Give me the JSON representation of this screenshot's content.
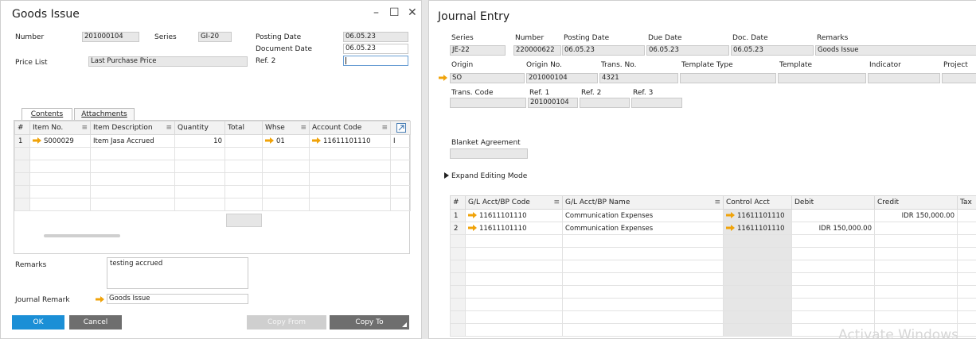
{
  "goods_issue": {
    "title": "Goods Issue",
    "controls": {
      "minimize": "–",
      "maximize": "☐",
      "close": "✕"
    },
    "number_label": "Number",
    "number_value": "201000104",
    "series_label": "Series",
    "series_value": "GI-20",
    "posting_date_label": "Posting Date",
    "posting_date_value": "06.05.23",
    "document_date_label": "Document Date",
    "document_date_value": "06.05.23",
    "ref2_label": "Ref. 2",
    "ref2_value": "",
    "price_list_label": "Price List",
    "price_list_value": "Last Purchase Price",
    "tabs": [
      "Contents",
      "Attachments"
    ],
    "columns": [
      "#",
      "Item No.",
      "Item Description",
      "Quantity",
      "Total",
      "Whse",
      "Account Code",
      ""
    ],
    "rows": [
      {
        "n": "1",
        "item_no": "S000029",
        "desc": "Item Jasa Accrued",
        "qty": "10",
        "total": "",
        "whse": "01",
        "account": "11611101110",
        "extra": "I"
      }
    ],
    "remarks_label": "Remarks",
    "remarks_value": "testing accrued",
    "journal_remark_label": "Journal Remark",
    "journal_remark_value": "Goods Issue",
    "buttons": {
      "ok": "OK",
      "cancel": "Cancel",
      "copy_from": "Copy From",
      "copy_to": "Copy To"
    }
  },
  "journal_entry": {
    "title": "Journal Entry",
    "header1_labels": {
      "series": "Series",
      "number": "Number",
      "posting_date": "Posting Date",
      "due_date": "Due Date",
      "doc_date": "Doc. Date",
      "remarks": "Remarks"
    },
    "header1_values": {
      "series": "JE-22",
      "number": "220000622",
      "posting_date": "06.05.23",
      "due_date": "06.05.23",
      "doc_date": "06.05.23",
      "remarks": "Goods Issue"
    },
    "header2_labels": {
      "origin": "Origin",
      "origin_no": "Origin No.",
      "trans_no": "Trans. No.",
      "template_type": "Template Type",
      "template": "Template",
      "indicator": "Indicator",
      "project": "Project"
    },
    "header2_values": {
      "origin": "SO",
      "origin_no": "201000104",
      "trans_no": "4321",
      "template_type": "",
      "template": "",
      "indicator": "",
      "project": ""
    },
    "header3_labels": {
      "trans_code": "Trans. Code",
      "ref1": "Ref. 1",
      "ref2": "Ref. 2",
      "ref3": "Ref. 3"
    },
    "header3_values": {
      "trans_code": "",
      "ref1": "201000104",
      "ref2": "",
      "ref3": ""
    },
    "blanket_label": "Blanket Agreement",
    "blanket_value": "",
    "expand_label": "Expand Editing Mode",
    "columns": [
      "#",
      "G/L Acct/BP Code",
      "G/L Acct/BP Name",
      "Control Acct",
      "Debit",
      "Credit",
      "Tax"
    ],
    "rows": [
      {
        "n": "1",
        "code": "11611101110",
        "name": "Communication Expenses",
        "control": "11611101110",
        "debit": "",
        "credit": "IDR 150,000.00"
      },
      {
        "n": "2",
        "code": "11611101110",
        "name": "Communication Expenses",
        "control": "11611101110",
        "debit": "IDR 150,000.00",
        "credit": ""
      }
    ],
    "watermark": "Activate Windows"
  },
  "colors": {
    "accent_blue": "#1b8fd6",
    "link_arrow": "#f0a30a",
    "field_grey": "#e8e8e8"
  },
  "icons": [
    "link-arrow-icon",
    "expand-triangle-icon",
    "form-settings-icon",
    "minimize-icon",
    "maximize-icon",
    "close-icon"
  ]
}
